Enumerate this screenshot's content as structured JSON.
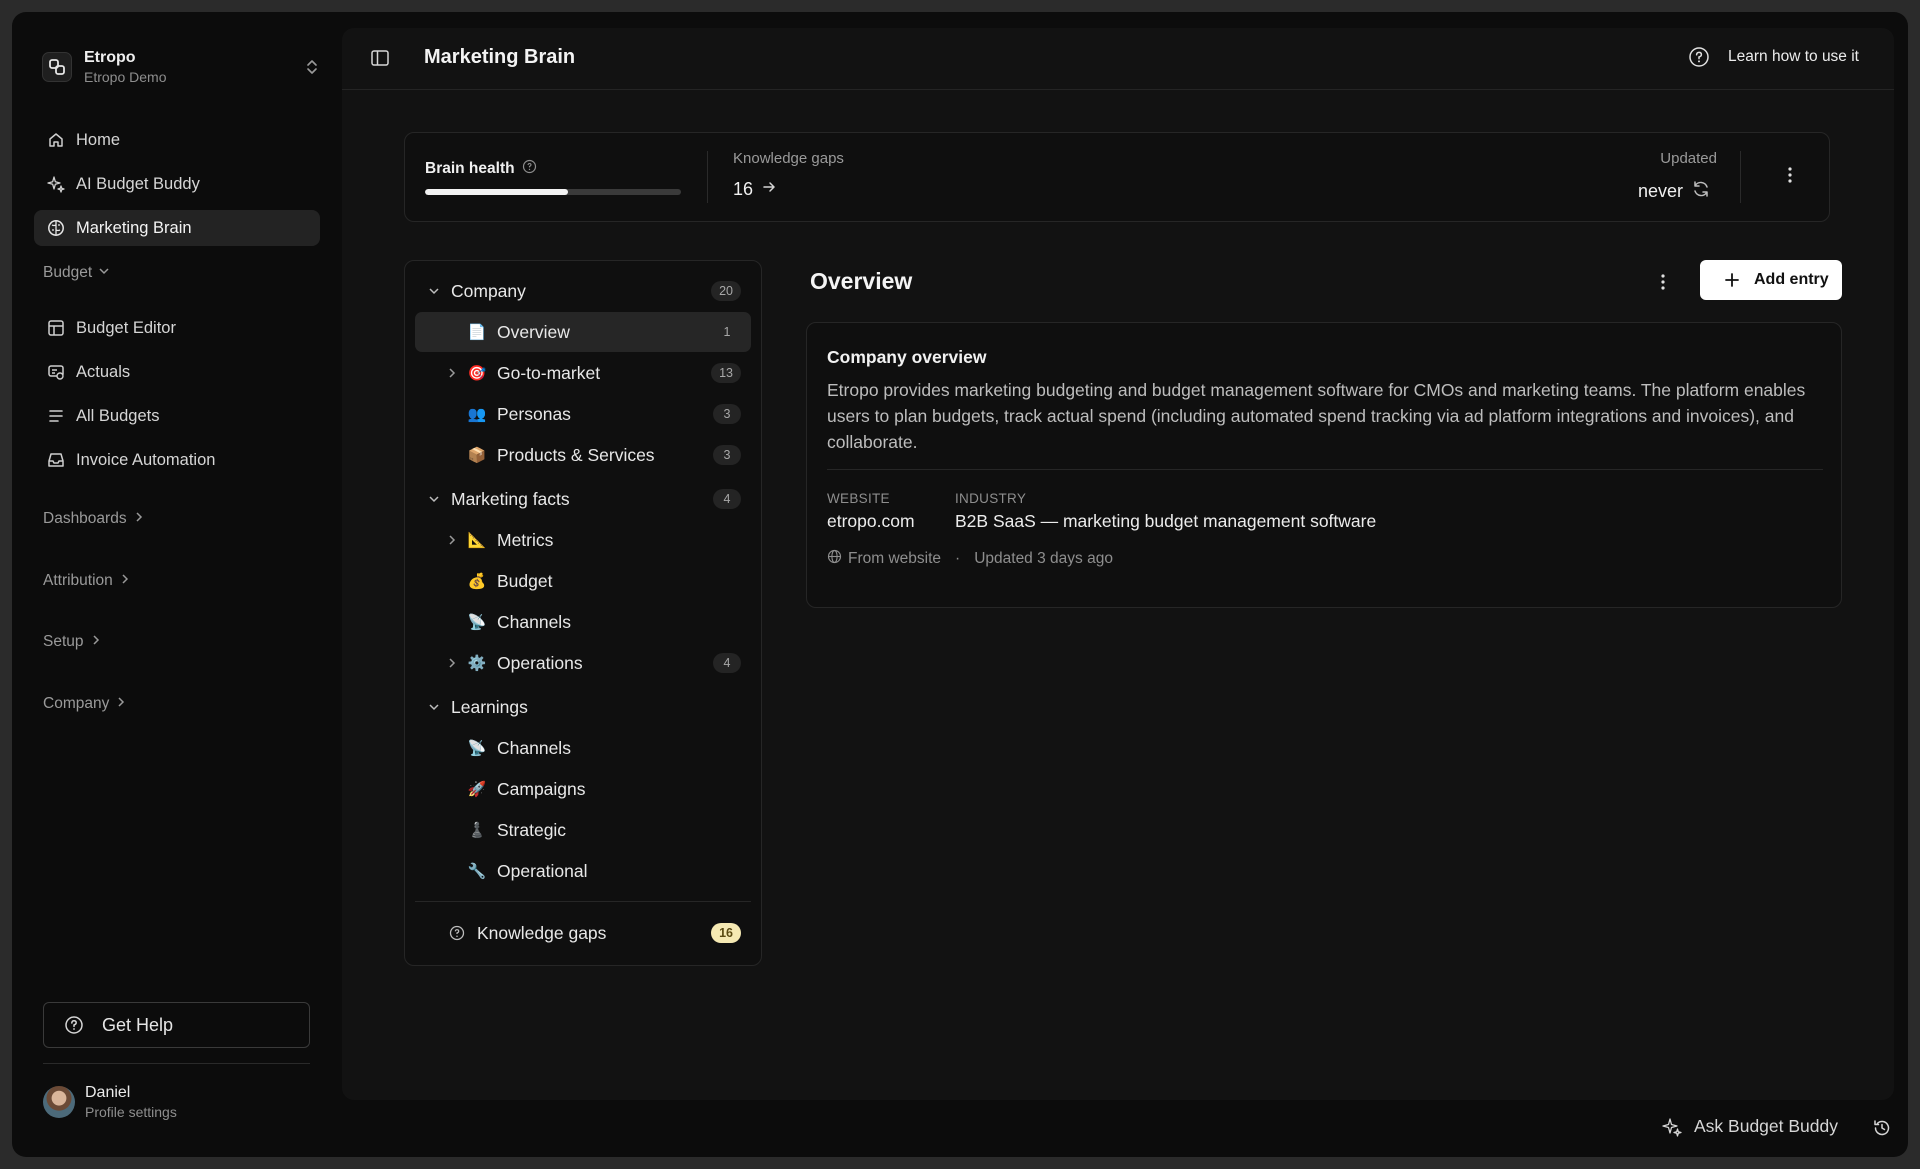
{
  "org": {
    "name": "Etropo",
    "subtitle": "Etropo Demo"
  },
  "sidebar": {
    "primary": [
      {
        "label": "Home",
        "icon": "home-icon"
      },
      {
        "label": "AI Budget Buddy",
        "icon": "sparkle-icon"
      },
      {
        "label": "Marketing Brain",
        "icon": "brain-icon",
        "active": true
      }
    ],
    "budget_section": "Budget",
    "budget_items": [
      {
        "label": "Budget Editor",
        "icon": "table-icon"
      },
      {
        "label": "Actuals",
        "icon": "receipt-icon"
      },
      {
        "label": "All Budgets",
        "icon": "list-icon"
      },
      {
        "label": "Invoice Automation",
        "icon": "inbox-icon"
      }
    ],
    "sections": [
      "Dashboards",
      "Attribution",
      "Setup",
      "Company"
    ],
    "help_label": "Get Help",
    "profile": {
      "name": "Daniel",
      "subtitle": "Profile settings"
    }
  },
  "header": {
    "title": "Marketing Brain",
    "learn_label": "Learn how to use it"
  },
  "health": {
    "label": "Brain health",
    "progress": 0.56,
    "gaps_label": "Knowledge gaps",
    "gaps_value": "16",
    "updated_label": "Updated",
    "updated_value": "never"
  },
  "tree": {
    "groups": [
      {
        "label": "Company",
        "count": "20",
        "expanded": true
      },
      {
        "label": "Marketing facts",
        "count": "4",
        "expanded": true
      },
      {
        "label": "Learnings",
        "count": "",
        "expanded": true
      }
    ],
    "company_items": [
      {
        "label": "Overview",
        "count": "1",
        "emoji": "📄",
        "active": true,
        "expandable": false
      },
      {
        "label": "Go-to-market",
        "count": "13",
        "emoji": "🎯",
        "expandable": true
      },
      {
        "label": "Personas",
        "count": "3",
        "emoji": "👥",
        "expandable": false
      },
      {
        "label": "Products & Services",
        "count": "3",
        "emoji": "📦",
        "expandable": false
      }
    ],
    "facts_items": [
      {
        "label": "Metrics",
        "count": "",
        "emoji": "📐",
        "expandable": true
      },
      {
        "label": "Budget",
        "count": "",
        "emoji": "💰",
        "expandable": false
      },
      {
        "label": "Channels",
        "count": "",
        "emoji": "📡",
        "expandable": false
      },
      {
        "label": "Operations",
        "count": "4",
        "emoji": "⚙️",
        "expandable": true
      }
    ],
    "learnings_items": [
      {
        "label": "Channels",
        "emoji": "📡"
      },
      {
        "label": "Campaigns",
        "emoji": "🚀"
      },
      {
        "label": "Strategic",
        "emoji": "♟️"
      },
      {
        "label": "Operational",
        "emoji": "🔧"
      }
    ],
    "gaps": {
      "label": "Knowledge gaps",
      "count": "16"
    }
  },
  "content": {
    "title": "Overview",
    "add_label": "Add entry",
    "card": {
      "heading": "Company overview",
      "body": "Etropo provides marketing budgeting and budget management software for CMOs and marketing teams. The platform enables users to plan budgets, track actual spend (including automated spend tracking via ad platform integrations and invoices), and collaborate.",
      "website_label": "WEBSITE",
      "website_value": "etropo.com",
      "industry_label": "INDUSTRY",
      "industry_value": "B2B SaaS — marketing budget management software",
      "source": "From website",
      "updated": "Updated 3 days ago"
    }
  },
  "footer": {
    "ask_label": "Ask Budget Buddy"
  }
}
